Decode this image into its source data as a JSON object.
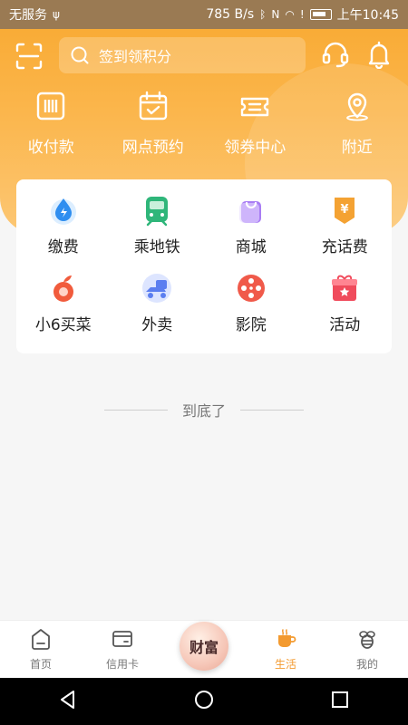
{
  "status_bar": {
    "carrier": "无服务",
    "speed": "785 B/s",
    "time": "上午10:45"
  },
  "search": {
    "placeholder": "签到领积分"
  },
  "quick_actions": [
    {
      "label": "收付款",
      "icon": "payment-code-icon"
    },
    {
      "label": "网点预约",
      "icon": "calendar-check-icon"
    },
    {
      "label": "领券中心",
      "icon": "ticket-icon"
    },
    {
      "label": "附近",
      "icon": "location-pin-icon"
    }
  ],
  "services": [
    {
      "label": "缴费",
      "icon": "water-drop-icon",
      "color": "#2f8ef0"
    },
    {
      "label": "乘地铁",
      "icon": "metro-icon",
      "color": "#2fb67a"
    },
    {
      "label": "商城",
      "icon": "shopping-bag-icon",
      "color": "#9b6cf0"
    },
    {
      "label": "充话费",
      "icon": "phone-bill-icon",
      "color": "#f4a233"
    },
    {
      "label": "小6买菜",
      "icon": "grocery-icon",
      "color": "#f15b3c"
    },
    {
      "label": "外卖",
      "icon": "delivery-scooter-icon",
      "color": "#5b7ef0"
    },
    {
      "label": "影院",
      "icon": "film-reel-icon",
      "color": "#f05a4a"
    },
    {
      "label": "活动",
      "icon": "gift-box-icon",
      "color": "#f04b5c"
    }
  ],
  "end_text": "到底了",
  "tabs": [
    {
      "label": "首页",
      "icon": "home-icon",
      "active": false
    },
    {
      "label": "信用卡",
      "icon": "credit-card-icon",
      "active": false
    },
    {
      "label": "生活",
      "icon": "coffee-cup-icon",
      "active": true
    },
    {
      "label": "我的",
      "icon": "bee-icon",
      "active": false
    }
  ],
  "center_button": {
    "label": "财富"
  },
  "colors": {
    "accent": "#f39a2f",
    "header_top": "#f8a82f",
    "header_bottom": "#fcc774"
  }
}
